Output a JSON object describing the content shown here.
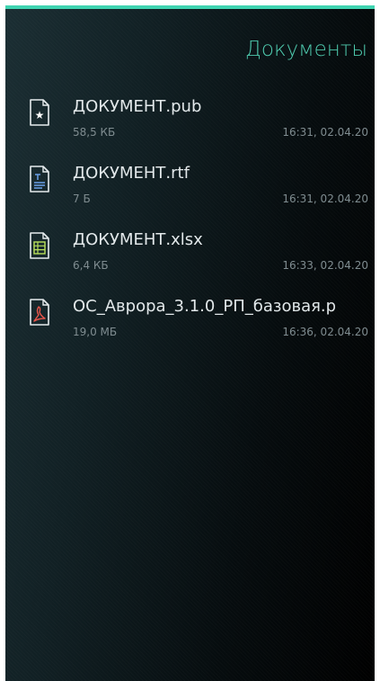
{
  "header": {
    "title": "Документы"
  },
  "files": [
    {
      "name": "ДОКУМЕНТ.pub",
      "size": "58,5 КБ",
      "date": "16:31, 02.04.20",
      "icon": "publisher-doc-icon"
    },
    {
      "name": "ДОКУМЕНТ.rtf",
      "size": "7 Б",
      "date": "16:31, 02.04.20",
      "icon": "text-doc-icon"
    },
    {
      "name": "ДОКУМЕНТ.xlsx",
      "size": "6,4 КБ",
      "date": "16:33, 02.04.20",
      "icon": "spreadsheet-icon"
    },
    {
      "name": "ОС_Аврора_3.1.0_РП_базовая.p",
      "size": "19,0 МБ",
      "date": "16:36, 02.04.20",
      "icon": "pdf-icon"
    }
  ],
  "colors": {
    "accent": "#3fd3b0",
    "title": "#4ec9ad",
    "text": "#e2e8ea",
    "secondary": "#7f8c90",
    "background": "#0b1517"
  }
}
